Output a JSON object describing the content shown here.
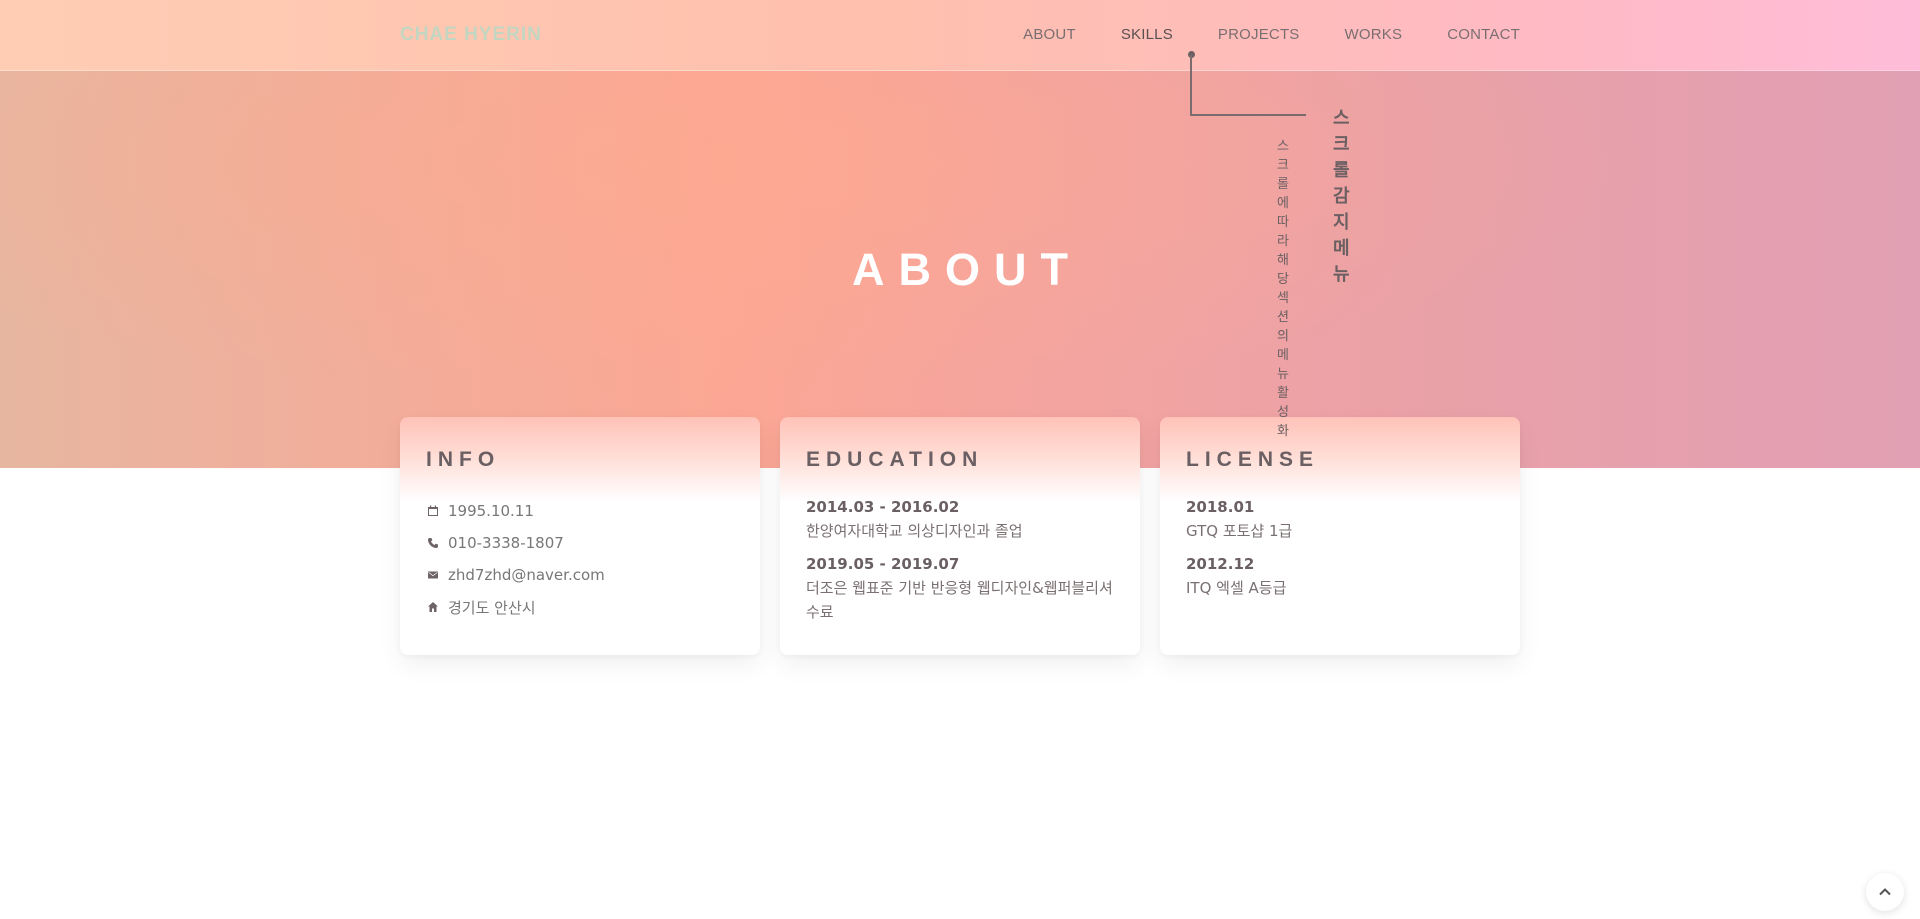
{
  "header": {
    "logo": "CHAE HYERIN",
    "nav": [
      {
        "label": "ABOUT",
        "active": false
      },
      {
        "label": "SKILLS",
        "active": true
      },
      {
        "label": "PROJECTS",
        "active": false
      },
      {
        "label": "WORKS",
        "active": false
      },
      {
        "label": "CONTACT",
        "active": false
      }
    ]
  },
  "annotation": {
    "title": "스크롤 감지 메뉴",
    "subtitle": "스크롤에 따라 해당 섹션의 메뉴 활성화"
  },
  "section": {
    "title": "ABOUT"
  },
  "cards": {
    "info": {
      "title": "INFO",
      "items": [
        {
          "icon": "calendar-icon",
          "text": "1995.10.11"
        },
        {
          "icon": "phone-icon",
          "text": "010-3338-1807"
        },
        {
          "icon": "mail-icon",
          "text": "zhd7zhd@naver.com"
        },
        {
          "icon": "home-icon",
          "text": "경기도 안산시"
        }
      ]
    },
    "education": {
      "title": "EDUCATION",
      "entries": [
        {
          "date": "2014.03 - 2016.02",
          "desc": "한양여자대학교 의상디자인과 졸업"
        },
        {
          "date": "2019.05 - 2019.07",
          "desc": "더조은 웹표준 기반 반응형 웹디자인&웹퍼블리셔 수료"
        }
      ]
    },
    "license": {
      "title": "LICENSE",
      "entries": [
        {
          "date": "2018.01",
          "desc": "GTQ 포토샵 1급"
        },
        {
          "date": "2012.12",
          "desc": "ITQ 엑셀 A등급"
        }
      ]
    }
  },
  "scroll_top": {
    "icon": "chevron-up-icon"
  }
}
